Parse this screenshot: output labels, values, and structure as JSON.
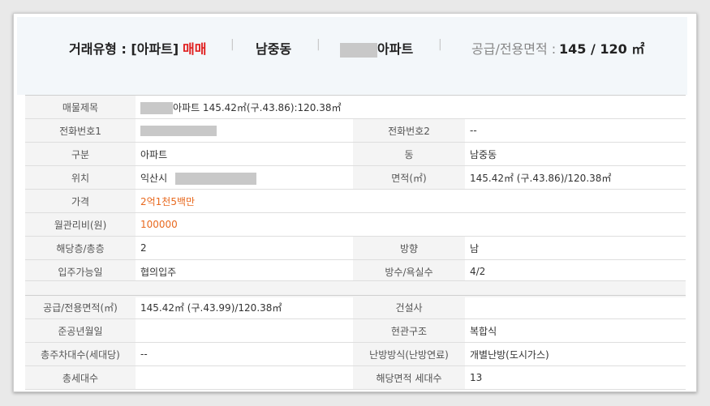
{
  "summary": {
    "deal_type_label": "거래유형 : [아파트]",
    "deal_type_value": "매매",
    "dong": "남중동",
    "apt_suffix": "아파트",
    "area_label": "공급/전용면적 :",
    "area_value": "145 / 120 ㎡"
  },
  "table1": {
    "title_label": "매물제목",
    "title_value": "아파트 145.42㎡(구.43.86):120.38㎡",
    "phone1_label": "전화번호1",
    "phone2_label": "전화번호2",
    "phone2_value": "--",
    "type_label": "구분",
    "type_value": "아파트",
    "dong_label": "동",
    "dong_value": "남중동",
    "location_label": "위치",
    "location_value": "익산시",
    "area_label": "면적(㎡)",
    "area_value": "145.42㎡ (구.43.86)/120.38㎡",
    "price_label": "가격",
    "price_value": "2억1천5백만",
    "fee_label": "월관리비(원)",
    "fee_value": "100000",
    "floor_label": "해당층/총층",
    "floor_value": "2",
    "direction_label": "방향",
    "direction_value": "남",
    "movein_label": "입주가능일",
    "movein_value": "협의입주",
    "rooms_label": "방수/욕실수",
    "rooms_value": "4/2"
  },
  "table2": {
    "supply_label": "공급/전용면적(㎡)",
    "supply_value": "145.42㎡ (구.43.99)/120.38㎡",
    "builder_label": "건설사",
    "builder_value": "",
    "completion_label": "준공년월일",
    "completion_value": "",
    "structure_label": "현관구조",
    "structure_value": "복합식",
    "parking_label": "총주차대수(세대당)",
    "parking_value": "--",
    "heating_label": "난방방식(난방연료)",
    "heating_value": "개별난방(도시가스)",
    "households_label": "총세대수",
    "households_value": "",
    "area_households_label": "해당면적 세대수",
    "area_households_value": "13"
  }
}
